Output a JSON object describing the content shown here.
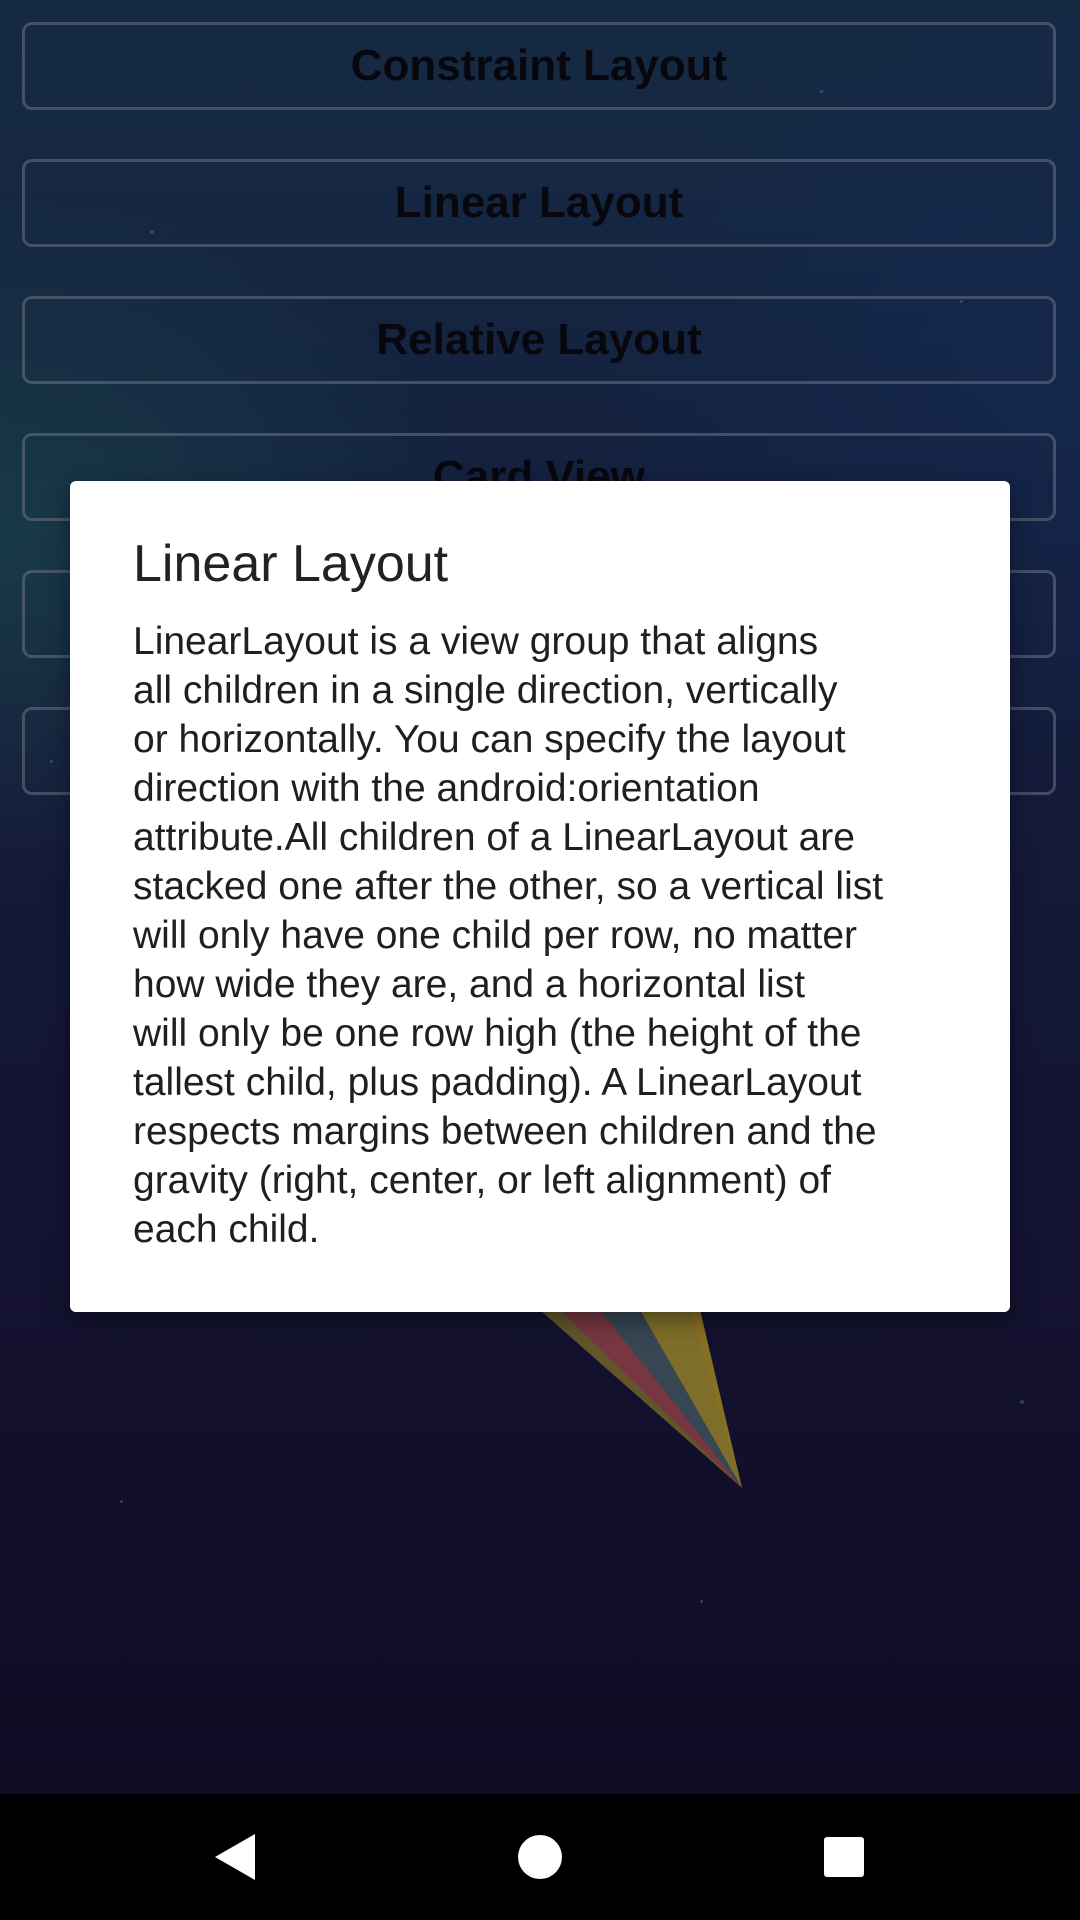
{
  "menu": {
    "items": [
      {
        "label": "Constraint Layout"
      },
      {
        "label": "Linear Layout"
      },
      {
        "label": "Relative Layout"
      },
      {
        "label": "Card View"
      },
      {
        "label": ""
      },
      {
        "label": ""
      }
    ]
  },
  "dialog": {
    "title": "Linear Layout",
    "body_lines": [
      "LinearLayout is a view group that aligns",
      "all children in a single direction, vertically",
      "or horizontally. You can specify the layout",
      "direction with the android:orientation",
      "attribute.All children of a LinearLayout are",
      "stacked one after the other, so a vertical list",
      "will only have one child per row, no matter",
      "how wide they are, and a horizontal list",
      "will only be one row high (the height of the",
      "tallest child, plus padding). A LinearLayout",
      "respects margins between children and the",
      "gravity (right, center, or left alignment) of",
      "each child."
    ]
  },
  "navbar": {
    "back_icon": "back-triangle-icon",
    "home_icon": "home-circle-icon",
    "recents_icon": "recents-square-icon"
  },
  "colors": {
    "dialog_background": "#ffffff",
    "navbar_background": "#000000",
    "nav_icon": "#ffffff"
  }
}
